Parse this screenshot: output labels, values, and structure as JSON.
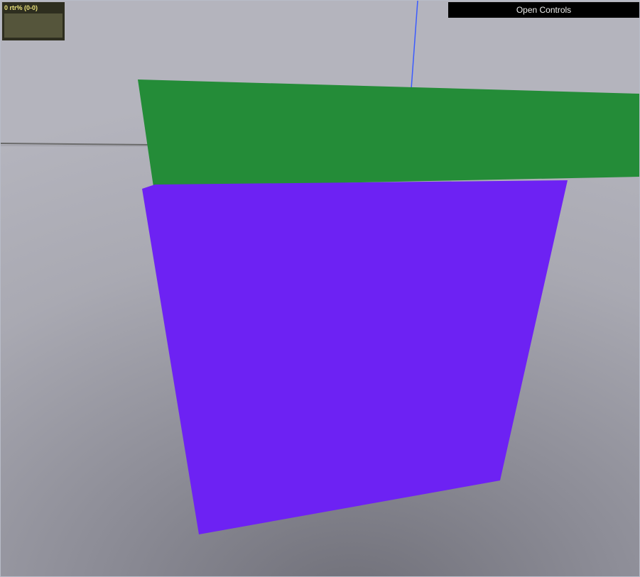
{
  "stats": {
    "label": "0 rtr% (0-0)"
  },
  "controls": {
    "open_label": "Open Controls"
  },
  "scene": {
    "background_colors": [
      "#b4b4bd",
      "#6f6f78"
    ],
    "green_plane_color": "#248c38",
    "purple_plane_color": "#6d22f3",
    "z_axis_color": "#3b5bff",
    "grid_line_color": "#6a6a6a"
  }
}
